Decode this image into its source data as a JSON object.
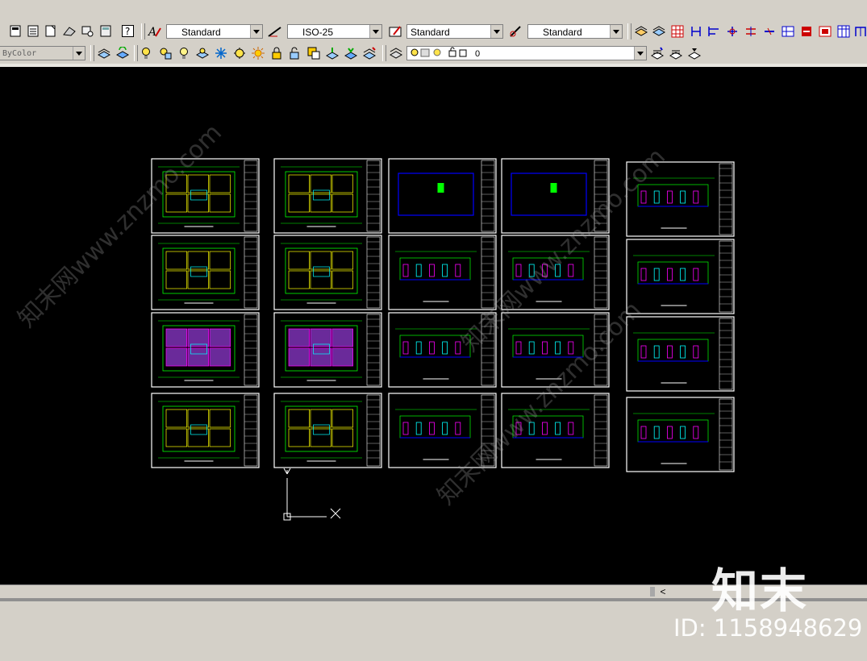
{
  "toolbar_top": {
    "text_style": "Standard",
    "dim_style": "ISO-25",
    "table_style": "Standard",
    "multileader_style": "Standard"
  },
  "toolbar_layers": {
    "color_control": "ByColor",
    "layer_name": "0"
  },
  "drawing": {
    "sheet_columns": 5,
    "sheet_rows": 4,
    "ucs_x_label": "X",
    "ucs_y_label": "Y"
  },
  "watermark": {
    "logo_text": "知末",
    "id_text": "ID: 1158948629",
    "diag_text": "知末网www.znzmo.com"
  },
  "colors": {
    "chrome": "#d4d0c8",
    "canvas": "#000000",
    "sheet_border": "#ffffff",
    "cad_green": "#00ff00",
    "cad_yellow": "#ffff00",
    "cad_blue": "#0000ff",
    "cad_magenta": "#ff00ff",
    "cad_cyan": "#00ffff"
  }
}
